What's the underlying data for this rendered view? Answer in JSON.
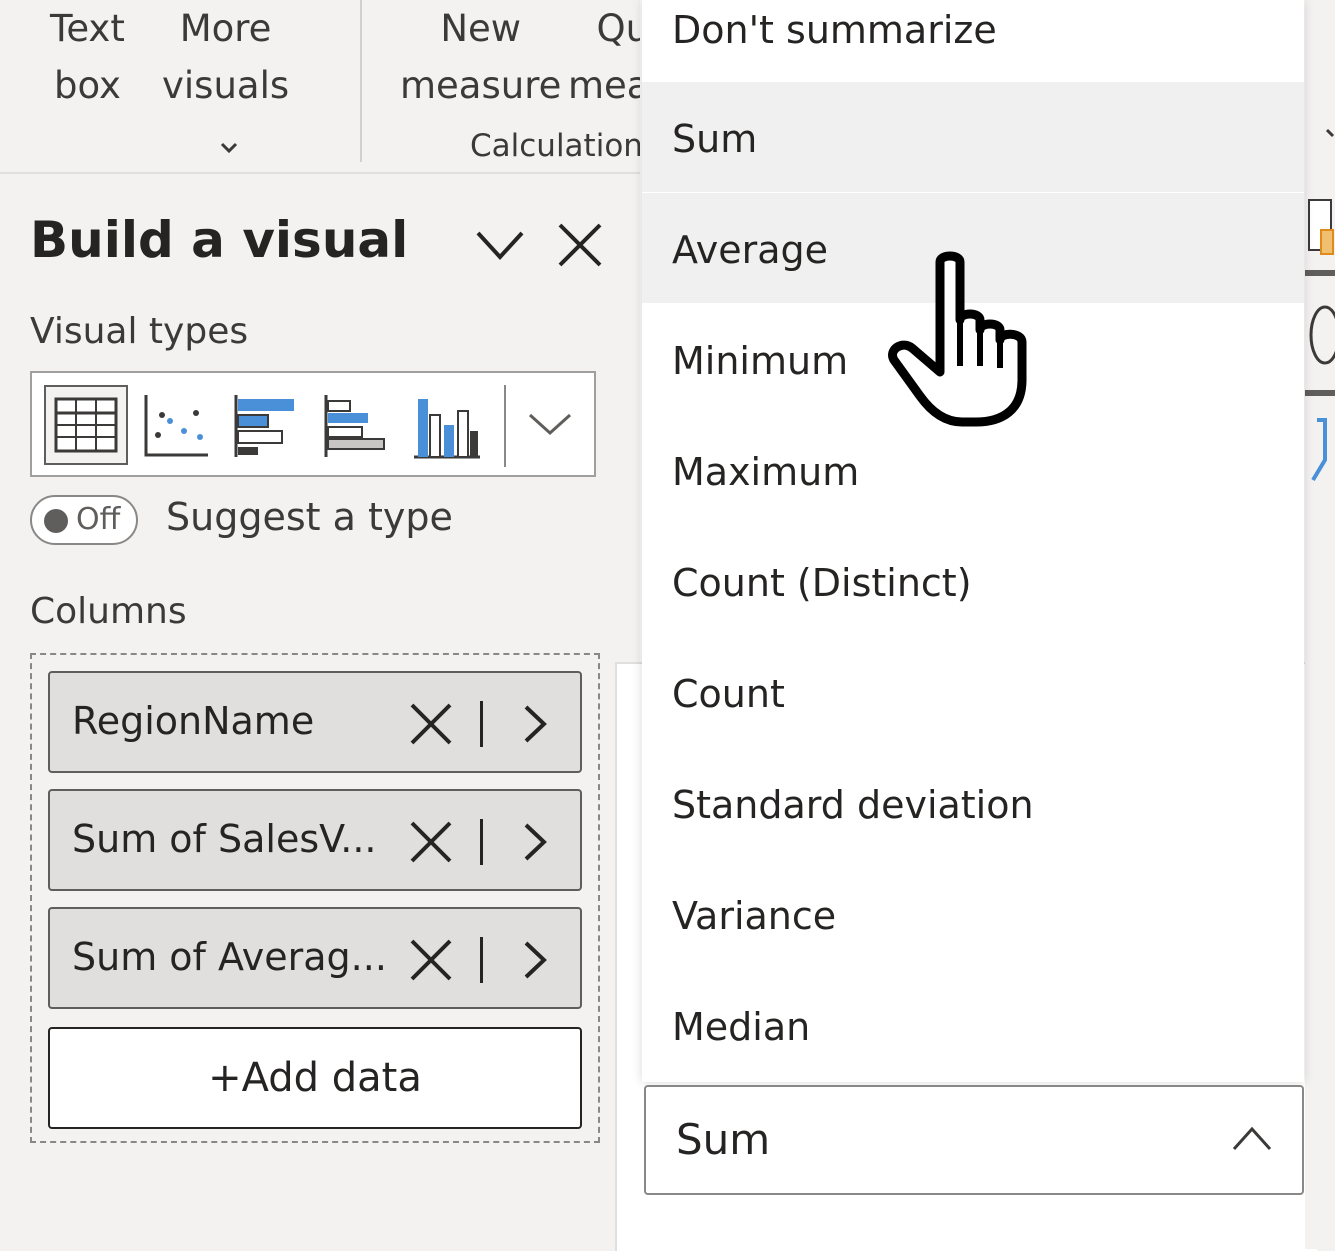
{
  "ribbon": {
    "text_box": {
      "line1": "Text",
      "line2": "box"
    },
    "more_visuals": {
      "line1": "More",
      "line2": "visuals"
    },
    "new_measure": {
      "line1": "New",
      "line2": "measure"
    },
    "quick_measure": {
      "line1": "Qu",
      "line2": "mea"
    },
    "group_label": "Calculation"
  },
  "panel": {
    "title": "Build a visual",
    "visual_types_label": "Visual types",
    "suggest_toggle_state": "Off",
    "suggest_label": "Suggest a type",
    "columns_label": "Columns",
    "fields": [
      {
        "label": "RegionName"
      },
      {
        "label": "Sum of SalesV..."
      },
      {
        "label": "Sum of Averag..."
      }
    ],
    "add_data_label": "+Add data"
  },
  "dropdown": {
    "options": [
      "Don't summarize",
      "Sum",
      "Average",
      "Minimum",
      "Maximum",
      "Count (Distinct)",
      "Count",
      "Standard deviation",
      "Variance",
      "Median"
    ],
    "highlighted_options": [
      "Sum",
      "Average"
    ],
    "selected_value": "Sum"
  },
  "colors": {
    "accent_blue": "#4a90d9",
    "panel_bg": "#f3f2f1",
    "field_bg": "#e1dfdd",
    "hover_bg": "#f0f0f0",
    "text": "#252423"
  }
}
